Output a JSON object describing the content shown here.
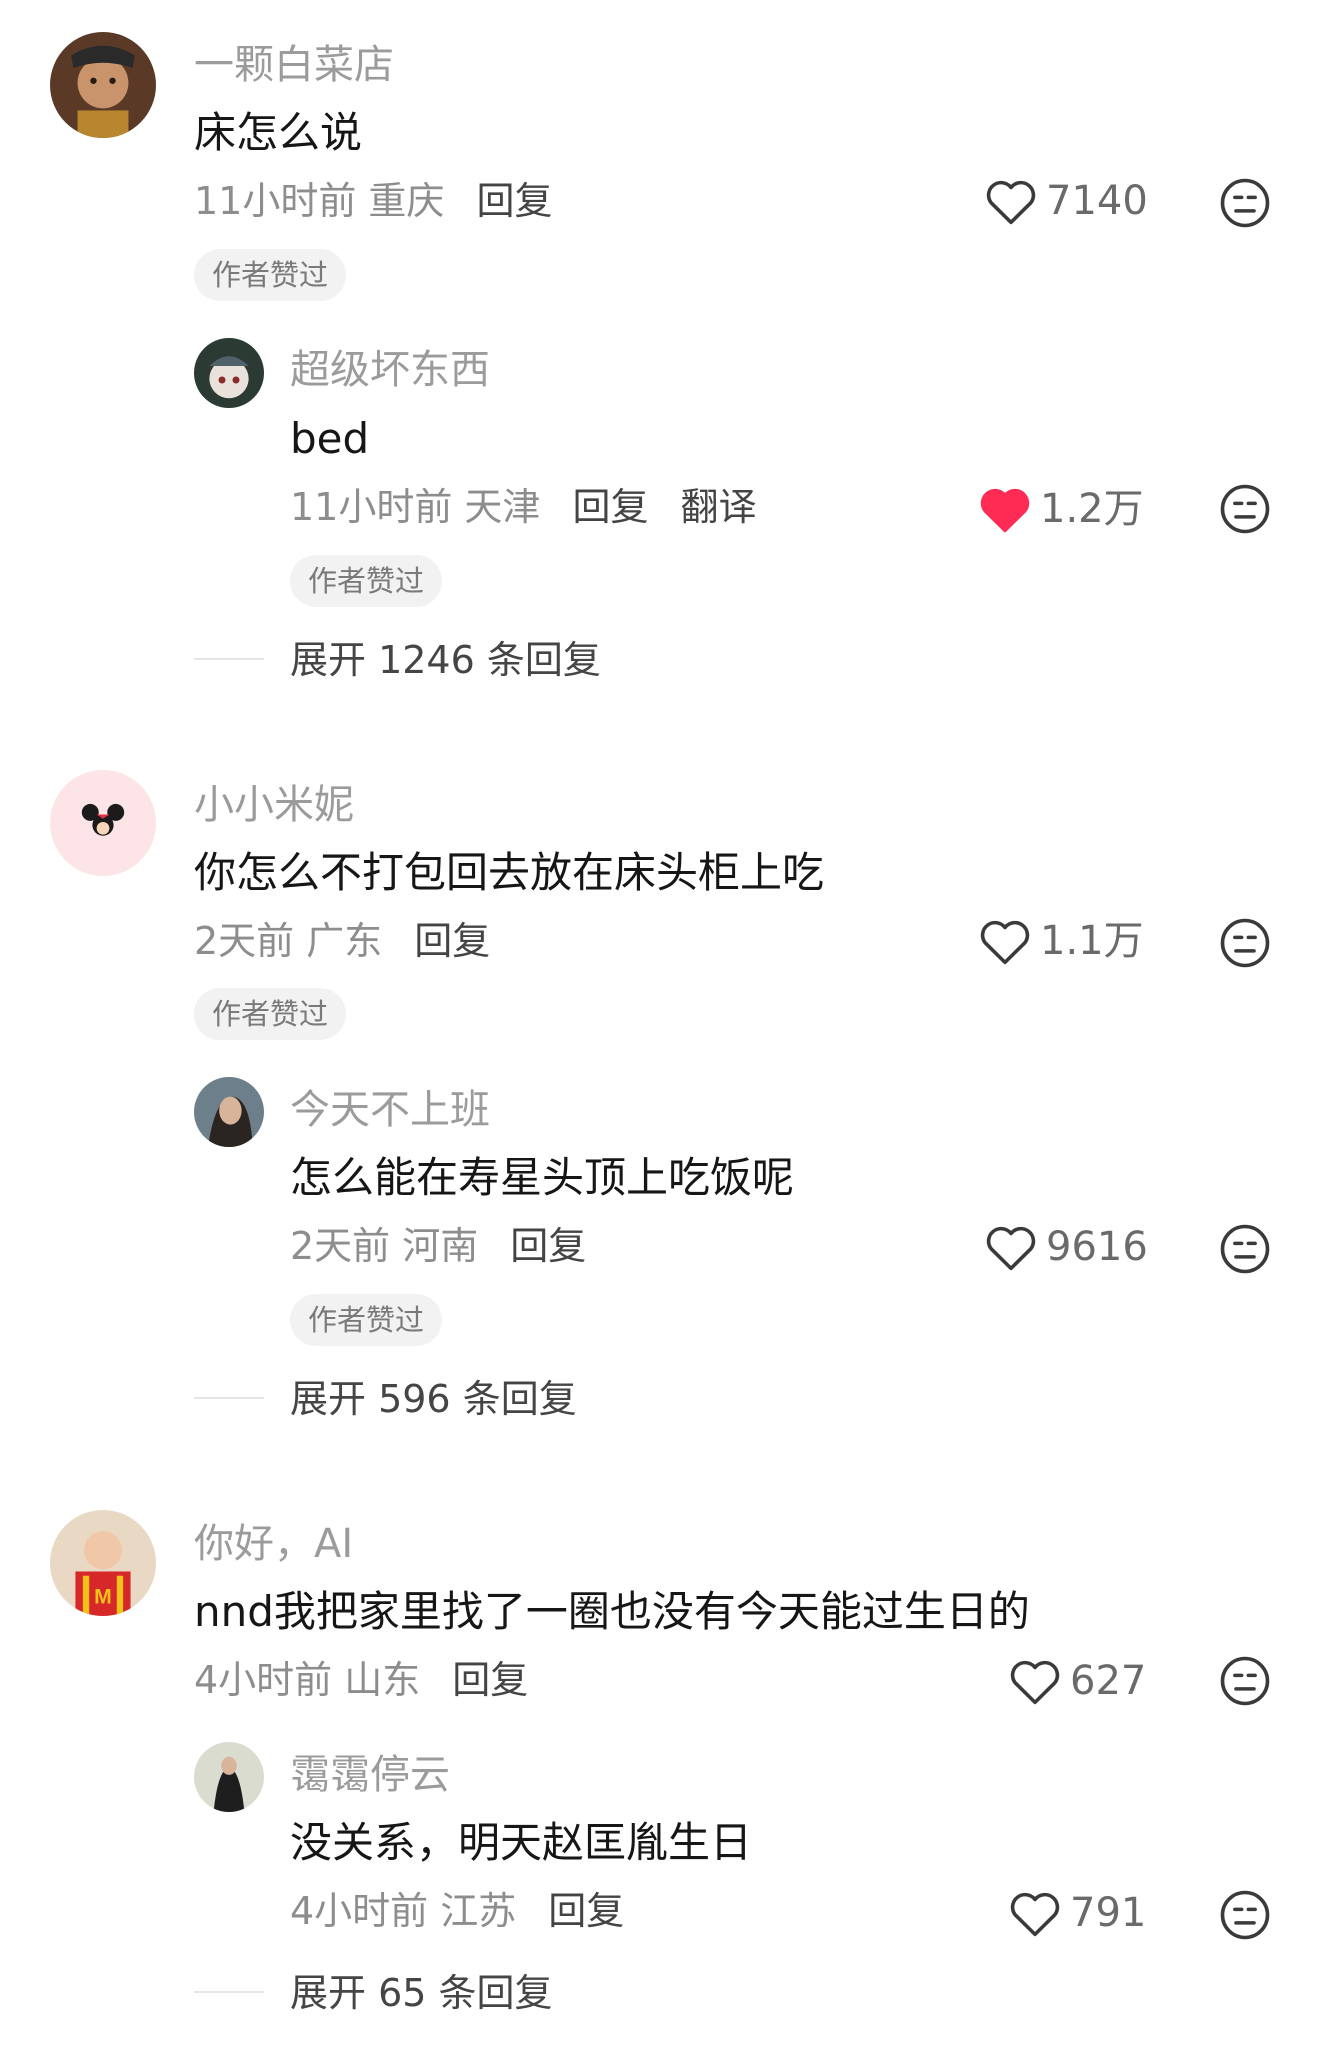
{
  "threads": [
    {
      "comment": {
        "name": "一颗白菜店",
        "text": "床怎么说",
        "time_location": "11小时前 重庆",
        "reply_label": "回复",
        "likes": "7140",
        "liked": false,
        "author_badge": "作者赞过"
      },
      "replies": [
        {
          "name": "超级坏东西",
          "text": "bed",
          "time_location": "11小时前 天津",
          "reply_label": "回复",
          "translate_label": "翻译",
          "likes": "1.2万",
          "liked": true,
          "author_badge": "作者赞过"
        }
      ],
      "expand_label": "展开 1246 条回复"
    },
    {
      "comment": {
        "name": "小小米妮",
        "text": "你怎么不打包回去放在床头柜上吃",
        "time_location": "2天前 广东",
        "reply_label": "回复",
        "likes": "1.1万",
        "liked": false,
        "author_badge": "作者赞过"
      },
      "replies": [
        {
          "name": "今天不上班",
          "text": "怎么能在寿星头顶上吃饭呢",
          "time_location": "2天前 河南",
          "reply_label": "回复",
          "likes": "9616",
          "liked": false,
          "author_badge": "作者赞过"
        }
      ],
      "expand_label": "展开 596 条回复"
    },
    {
      "comment": {
        "name": "你好，AI",
        "text": "nnd我把家里找了一圈也没有今天能过生日的",
        "time_location": "4小时前 山东",
        "reply_label": "回复",
        "likes": "627",
        "liked": false
      },
      "replies": [
        {
          "name": "霭霭停云",
          "text": "没关系，明天赵匡胤生日",
          "time_location": "4小时前 江苏",
          "reply_label": "回复",
          "likes": "791",
          "liked": false
        }
      ],
      "expand_label": "展开 65 条回复"
    }
  ],
  "icons": {
    "like": "heart-outline-icon",
    "liked": "heart-filled-icon",
    "dislike": "meh-face-icon"
  },
  "colors": {
    "liked_heart": "#fe2c55",
    "badge_bg": "#f2f2f2",
    "name": "#9b9b9b",
    "meta": "#8d8d8d"
  }
}
